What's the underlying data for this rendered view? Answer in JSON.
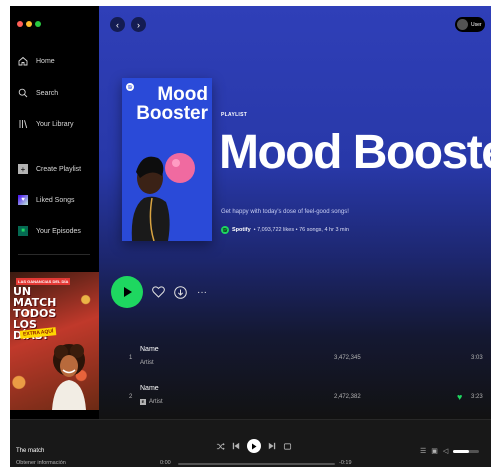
{
  "sidebar": {
    "nav": [
      {
        "label": "Home",
        "icon": "home-icon"
      },
      {
        "label": "Search",
        "icon": "search-icon"
      },
      {
        "label": "Your Library",
        "icon": "library-icon"
      }
    ],
    "actions": [
      {
        "label": "Create Playlist",
        "icon": "plus-icon"
      },
      {
        "label": "Liked Songs",
        "icon": "heart-icon"
      },
      {
        "label": "Your Episodes",
        "icon": "bookmark-icon"
      }
    ],
    "ad": {
      "top_text": "LAS GANANCIAS DEL DÍA",
      "title": "UN MATCH TODOS LOS DÍAS?",
      "badge": "EXTRA AQUÍ"
    }
  },
  "header": {
    "user_label": "User"
  },
  "playlist": {
    "cover_title": "Mood\nBooster",
    "type": "PLAYLIST",
    "title": "Mood Booster",
    "description": "Get happy with today's dose of feel-good songs!",
    "owner": "Spotify",
    "meta": " • 7,093,722 likes • 76 songs, 4 hr 3 min"
  },
  "tracks": [
    {
      "num": "1",
      "name": "Name",
      "artist": "Artist",
      "plays": "3,472,345",
      "duration": "3:03",
      "explicit": false,
      "liked": false
    },
    {
      "num": "2",
      "name": "Name",
      "artist": "Artist",
      "plays": "2,472,382",
      "duration": "3:23",
      "explicit": true,
      "liked": true
    }
  ],
  "player": {
    "title": "The match",
    "subtitle": "Obtener información",
    "time_elapsed": "0:00",
    "time_remaining": "-0:19",
    "progress": 0.0,
    "volume": 0.6
  },
  "colors": {
    "accent": "#1ed760",
    "header_blue": "#2f3fb8"
  }
}
